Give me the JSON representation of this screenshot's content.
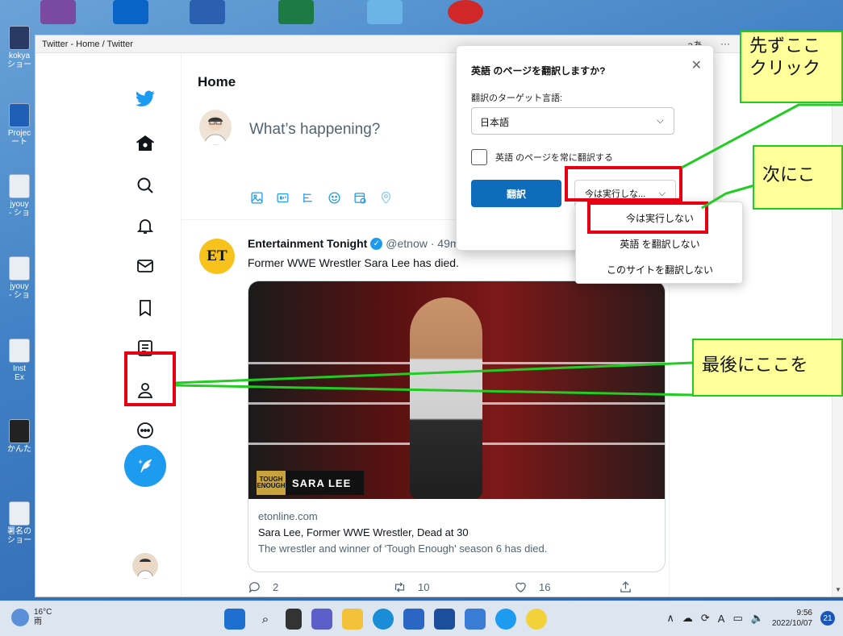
{
  "window": {
    "title": "Twitter - Home / Twitter",
    "font_toggle": "aあ",
    "more": "···"
  },
  "desktop_icons": [
    {
      "label": "kokya\nショー"
    },
    {
      "label": "Projec\nート"
    },
    {
      "label": "jyouy\n- ショ"
    },
    {
      "label": "jyouy\n- ショ"
    },
    {
      "label": "Inst\nEx"
    },
    {
      "label": "かんた"
    },
    {
      "label": "署名の\nショー"
    }
  ],
  "twitter": {
    "home_title": "Home",
    "compose_placeholder": "What’s happening?",
    "tweet": {
      "author": "Entertainment Tonight",
      "handle": "@etnow · 49m",
      "avatar_text": "ET",
      "text": "Former WWE Wrestler Sara Lee has died.",
      "image_logo": "TOUGH ENOUGH",
      "image_name": "SARA LEE",
      "card_domain": "etonline.com",
      "card_title": "Sara Lee, Former WWE Wrestler, Dead at 30",
      "card_desc": "The wrestler and winner of 'Tough Enough' season 6 has died.",
      "replies": "2",
      "retweets": "10",
      "likes": "16"
    }
  },
  "translate_popup": {
    "question": "英語 のページを翻訳しますか?",
    "target_label": "翻訳のターゲット言語:",
    "target_value": "日本語",
    "always_translate": "英語 のページを常に翻訳する",
    "translate_button": "翻訳",
    "not_now_button": "今は実行しな...",
    "dropdown_options": [
      "今は実行しない",
      "英語 を翻訳しない",
      "このサイトを翻訳しない"
    ]
  },
  "callouts": {
    "first": "先ずここ\nクリック",
    "next": "次にこ",
    "last": "最後にここを"
  },
  "taskbar": {
    "temp": "16°C",
    "weather": "雨",
    "time": "9:56",
    "date": "2022/10/07",
    "notif_count": "21",
    "ime": "A"
  },
  "colors": {
    "twitter_blue": "#1d9bf0",
    "edge_blue": "#0f6cbd",
    "highlight_red": "#e60012",
    "callout_yellow": "#ffff99",
    "callout_border": "#22cc22"
  }
}
